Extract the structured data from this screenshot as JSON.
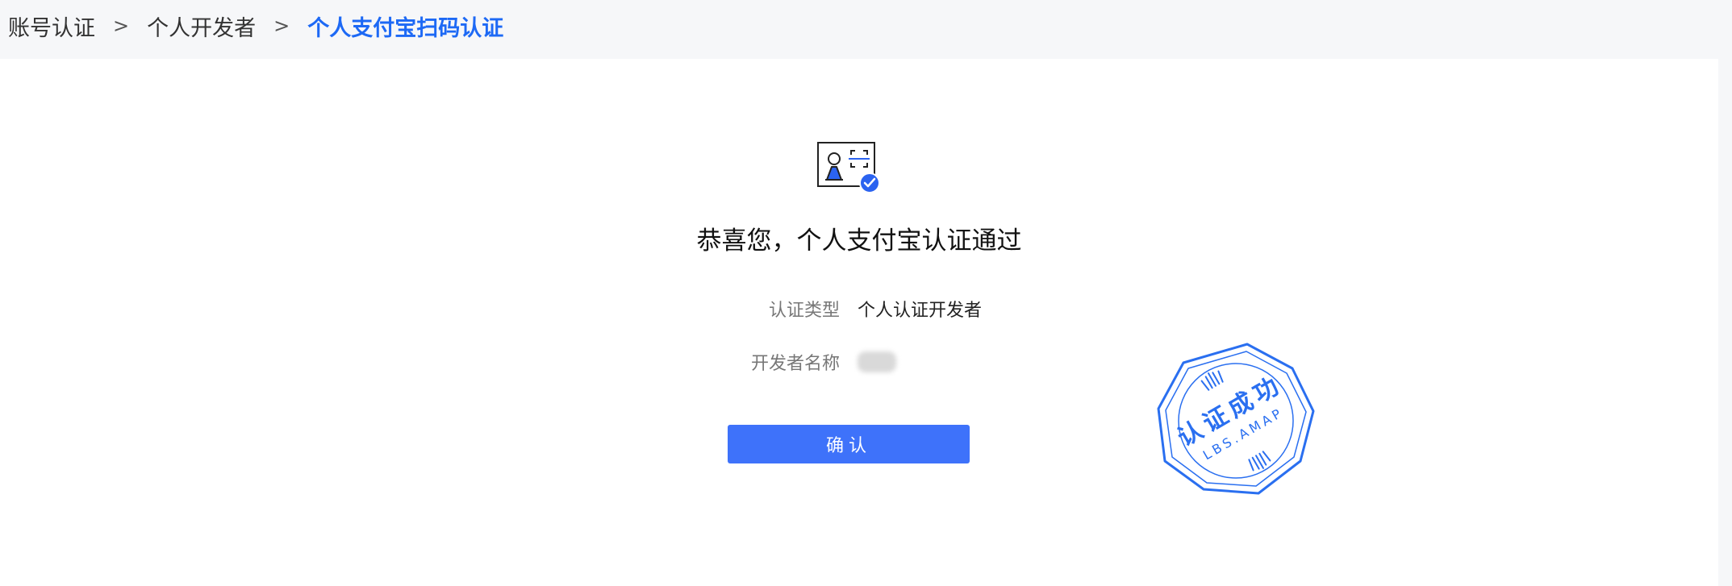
{
  "breadcrumb": {
    "items": [
      "账号认证",
      "个人开发者"
    ],
    "separator": ">",
    "current": "个人支付宝扫码认证"
  },
  "result": {
    "title": "恭喜您，个人支付宝认证通过",
    "type_label": "认证类型",
    "type_value": "个人认证开发者",
    "name_label": "开发者名称",
    "name_value_redacted": true
  },
  "actions": {
    "confirm_label": "确认"
  },
  "stamp": {
    "main_text": "认证成功",
    "sub_text": "LBS.AMAP"
  },
  "colors": {
    "accent": "#1d69f5",
    "button": "#3e72fa",
    "stamp": "#2a6ff0"
  },
  "icons": {
    "success": "id-card-verified-icon",
    "stamp": "verified-stamp-icon"
  }
}
